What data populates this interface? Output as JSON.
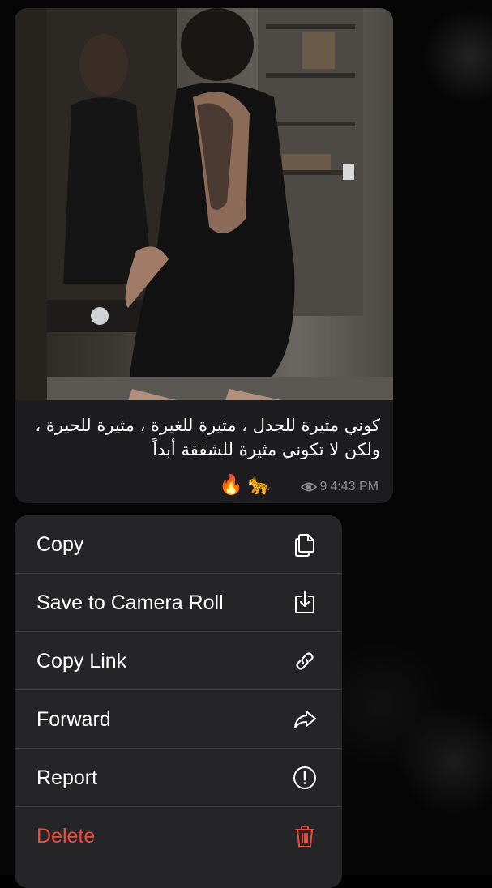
{
  "message": {
    "text": "كوني مثيرة للجدل ، مثيرة للغيرة ، مثيرة للحيرة ، ولكن لا تكوني مثيرة للشفقة أبداً",
    "reactions": [
      "🔥",
      "🐆"
    ],
    "views": "9",
    "time": "4:43 PM"
  },
  "context_menu": {
    "items": [
      {
        "label": "Copy",
        "icon": "copy-icon"
      },
      {
        "label": "Save to Camera Roll",
        "icon": "save-download-icon"
      },
      {
        "label": "Copy Link",
        "icon": "link-icon"
      },
      {
        "label": "Forward",
        "icon": "forward-arrow-icon"
      },
      {
        "label": "Report",
        "icon": "report-exclamation-icon"
      },
      {
        "label": "Delete",
        "icon": "trash-icon",
        "destructive": true
      }
    ]
  },
  "colors": {
    "background": "#000000",
    "bubble": "#1d1d1f",
    "menu": "#252527",
    "destructive": "#eb4d3d",
    "meta_text": "#8e8e93"
  }
}
